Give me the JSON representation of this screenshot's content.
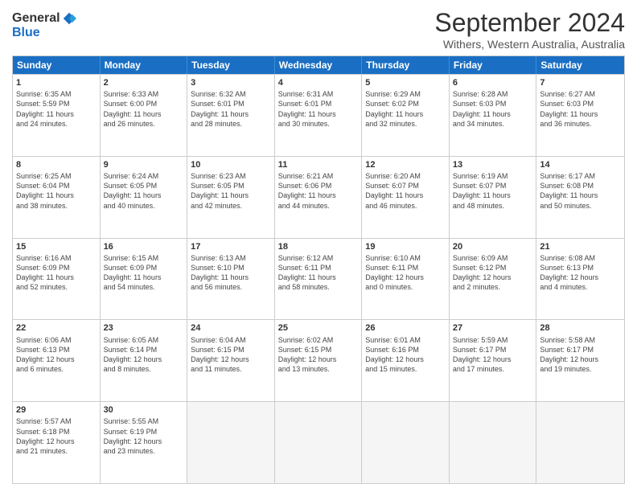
{
  "logo": {
    "general": "General",
    "blue": "Blue"
  },
  "title": "September 2024",
  "subtitle": "Withers, Western Australia, Australia",
  "days": [
    "Sunday",
    "Monday",
    "Tuesday",
    "Wednesday",
    "Thursday",
    "Friday",
    "Saturday"
  ],
  "weeks": [
    [
      {
        "day": "1",
        "sunrise": "6:35 AM",
        "sunset": "5:59 PM",
        "daylight": "11 hours and 24 minutes."
      },
      {
        "day": "2",
        "sunrise": "6:33 AM",
        "sunset": "6:00 PM",
        "daylight": "11 hours and 26 minutes."
      },
      {
        "day": "3",
        "sunrise": "6:32 AM",
        "sunset": "6:01 PM",
        "daylight": "11 hours and 28 minutes."
      },
      {
        "day": "4",
        "sunrise": "6:31 AM",
        "sunset": "6:01 PM",
        "daylight": "11 hours and 30 minutes."
      },
      {
        "day": "5",
        "sunrise": "6:29 AM",
        "sunset": "6:02 PM",
        "daylight": "11 hours and 32 minutes."
      },
      {
        "day": "6",
        "sunrise": "6:28 AM",
        "sunset": "6:03 PM",
        "daylight": "11 hours and 34 minutes."
      },
      {
        "day": "7",
        "sunrise": "6:27 AM",
        "sunset": "6:03 PM",
        "daylight": "11 hours and 36 minutes."
      }
    ],
    [
      {
        "day": "8",
        "sunrise": "6:25 AM",
        "sunset": "6:04 PM",
        "daylight": "11 hours and 38 minutes."
      },
      {
        "day": "9",
        "sunrise": "6:24 AM",
        "sunset": "6:05 PM",
        "daylight": "11 hours and 40 minutes."
      },
      {
        "day": "10",
        "sunrise": "6:23 AM",
        "sunset": "6:05 PM",
        "daylight": "11 hours and 42 minutes."
      },
      {
        "day": "11",
        "sunrise": "6:21 AM",
        "sunset": "6:06 PM",
        "daylight": "11 hours and 44 minutes."
      },
      {
        "day": "12",
        "sunrise": "6:20 AM",
        "sunset": "6:07 PM",
        "daylight": "11 hours and 46 minutes."
      },
      {
        "day": "13",
        "sunrise": "6:19 AM",
        "sunset": "6:07 PM",
        "daylight": "11 hours and 48 minutes."
      },
      {
        "day": "14",
        "sunrise": "6:17 AM",
        "sunset": "6:08 PM",
        "daylight": "11 hours and 50 minutes."
      }
    ],
    [
      {
        "day": "15",
        "sunrise": "6:16 AM",
        "sunset": "6:09 PM",
        "daylight": "11 hours and 52 minutes."
      },
      {
        "day": "16",
        "sunrise": "6:15 AM",
        "sunset": "6:09 PM",
        "daylight": "11 hours and 54 minutes."
      },
      {
        "day": "17",
        "sunrise": "6:13 AM",
        "sunset": "6:10 PM",
        "daylight": "11 hours and 56 minutes."
      },
      {
        "day": "18",
        "sunrise": "6:12 AM",
        "sunset": "6:11 PM",
        "daylight": "11 hours and 58 minutes."
      },
      {
        "day": "19",
        "sunrise": "6:10 AM",
        "sunset": "6:11 PM",
        "daylight": "12 hours and 0 minutes."
      },
      {
        "day": "20",
        "sunrise": "6:09 AM",
        "sunset": "6:12 PM",
        "daylight": "12 hours and 2 minutes."
      },
      {
        "day": "21",
        "sunrise": "6:08 AM",
        "sunset": "6:13 PM",
        "daylight": "12 hours and 4 minutes."
      }
    ],
    [
      {
        "day": "22",
        "sunrise": "6:06 AM",
        "sunset": "6:13 PM",
        "daylight": "12 hours and 6 minutes."
      },
      {
        "day": "23",
        "sunrise": "6:05 AM",
        "sunset": "6:14 PM",
        "daylight": "12 hours and 8 minutes."
      },
      {
        "day": "24",
        "sunrise": "6:04 AM",
        "sunset": "6:15 PM",
        "daylight": "12 hours and 11 minutes."
      },
      {
        "day": "25",
        "sunrise": "6:02 AM",
        "sunset": "6:15 PM",
        "daylight": "12 hours and 13 minutes."
      },
      {
        "day": "26",
        "sunrise": "6:01 AM",
        "sunset": "6:16 PM",
        "daylight": "12 hours and 15 minutes."
      },
      {
        "day": "27",
        "sunrise": "5:59 AM",
        "sunset": "6:17 PM",
        "daylight": "12 hours and 17 minutes."
      },
      {
        "day": "28",
        "sunrise": "5:58 AM",
        "sunset": "6:17 PM",
        "daylight": "12 hours and 19 minutes."
      }
    ],
    [
      {
        "day": "29",
        "sunrise": "5:57 AM",
        "sunset": "6:18 PM",
        "daylight": "12 hours and 21 minutes."
      },
      {
        "day": "30",
        "sunrise": "5:55 AM",
        "sunset": "6:19 PM",
        "daylight": "12 hours and 23 minutes."
      },
      null,
      null,
      null,
      null,
      null
    ]
  ],
  "labels": {
    "sunrise": "Sunrise:",
    "sunset": "Sunset:",
    "daylight": "Daylight:"
  }
}
